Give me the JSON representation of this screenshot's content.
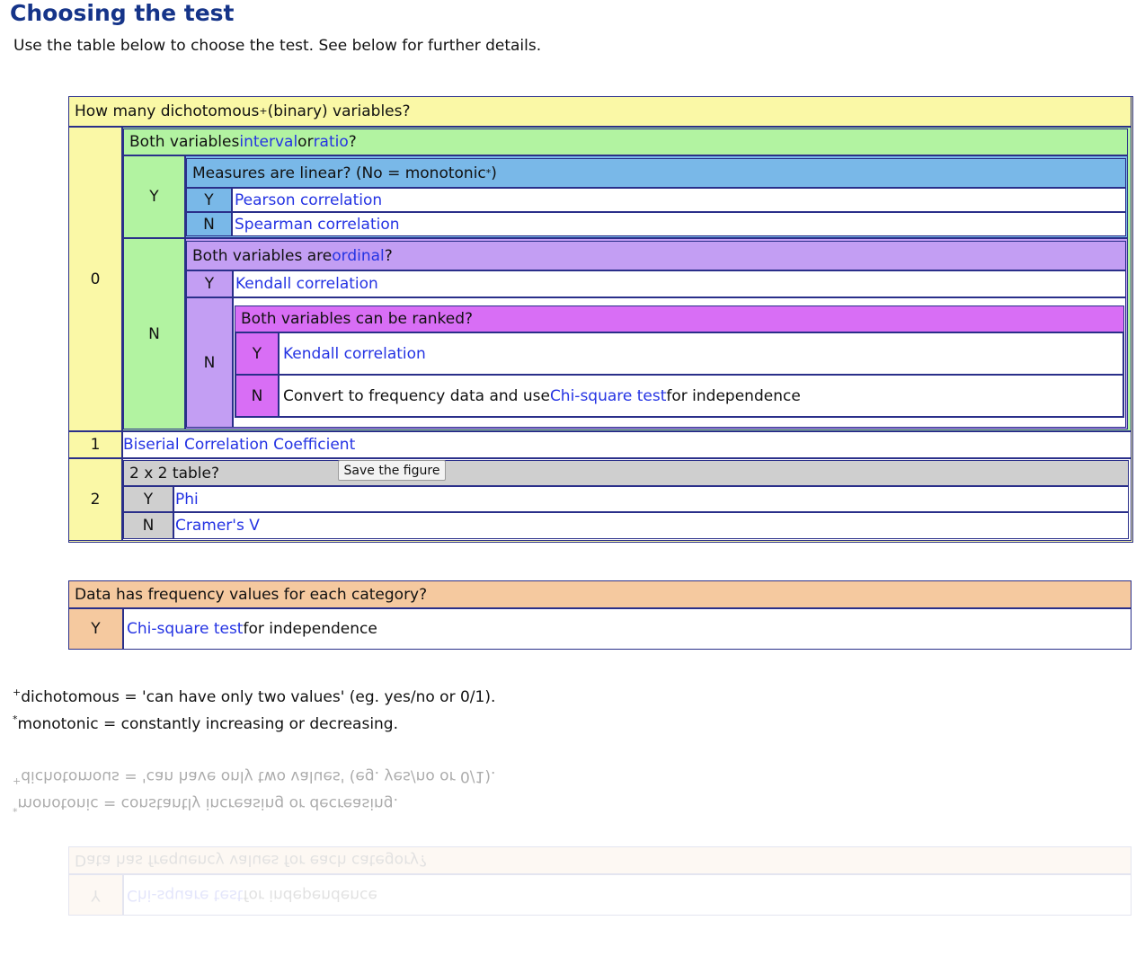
{
  "page": {
    "title": "Choosing the test",
    "intro": "Use the table below to choose the test. See below for further details."
  },
  "main_table": {
    "question": "How many dichotomous",
    "question_sup": "+",
    "question_tail": " (binary) variables?",
    "row0_label": "0",
    "row1_label": "1",
    "row2_label": "2",
    "q_interval_pre": "Both variables ",
    "q_interval_link1": "interval",
    "q_interval_mid": " or ",
    "q_interval_link2": "ratio",
    "q_interval_post": "?",
    "y": "Y",
    "n": "N",
    "q_linear": "Measures are linear? (No = monotonic",
    "q_linear_sup": "*",
    "q_linear_post": ")",
    "pearson": "Pearson correlation",
    "spearman": "Spearman correlation",
    "q_ordinal_pre": "Both variables are ",
    "q_ordinal_link": "ordinal",
    "q_ordinal_post": "?",
    "kendall": "Kendall correlation",
    "q_ranked": "Both variables can be ranked?",
    "convert_pre": "Convert to frequency data and use ",
    "convert_link": "Chi-square test",
    "convert_post": " for independence",
    "biserial": "Biserial Correlation Coefficient",
    "q_2x2": "2 x 2 table?",
    "phi": "Phi",
    "cramers": "Cramer's V"
  },
  "tooltip": "Save the figure",
  "freq_table": {
    "question": "Data has frequency values for each category?",
    "y": "Y",
    "link": "Chi-square test",
    "post": " for independence"
  },
  "notes": {
    "dich_sup": "+",
    "dich": "dichotomous = 'can have only two values' (eg. yes/no or 0/1).",
    "mono_sup": "*",
    "mono": "monotonic = constantly increasing or decreasing."
  },
  "colors": {
    "yellow": "#faf8a6",
    "green": "#b2f3a1",
    "blue": "#79b8e8",
    "lilac": "#c39ef3",
    "magenta": "#d86ef5",
    "grey": "#cfcfcf",
    "peach": "#f5c99f",
    "link": "#2433e3",
    "title": "#153489"
  }
}
